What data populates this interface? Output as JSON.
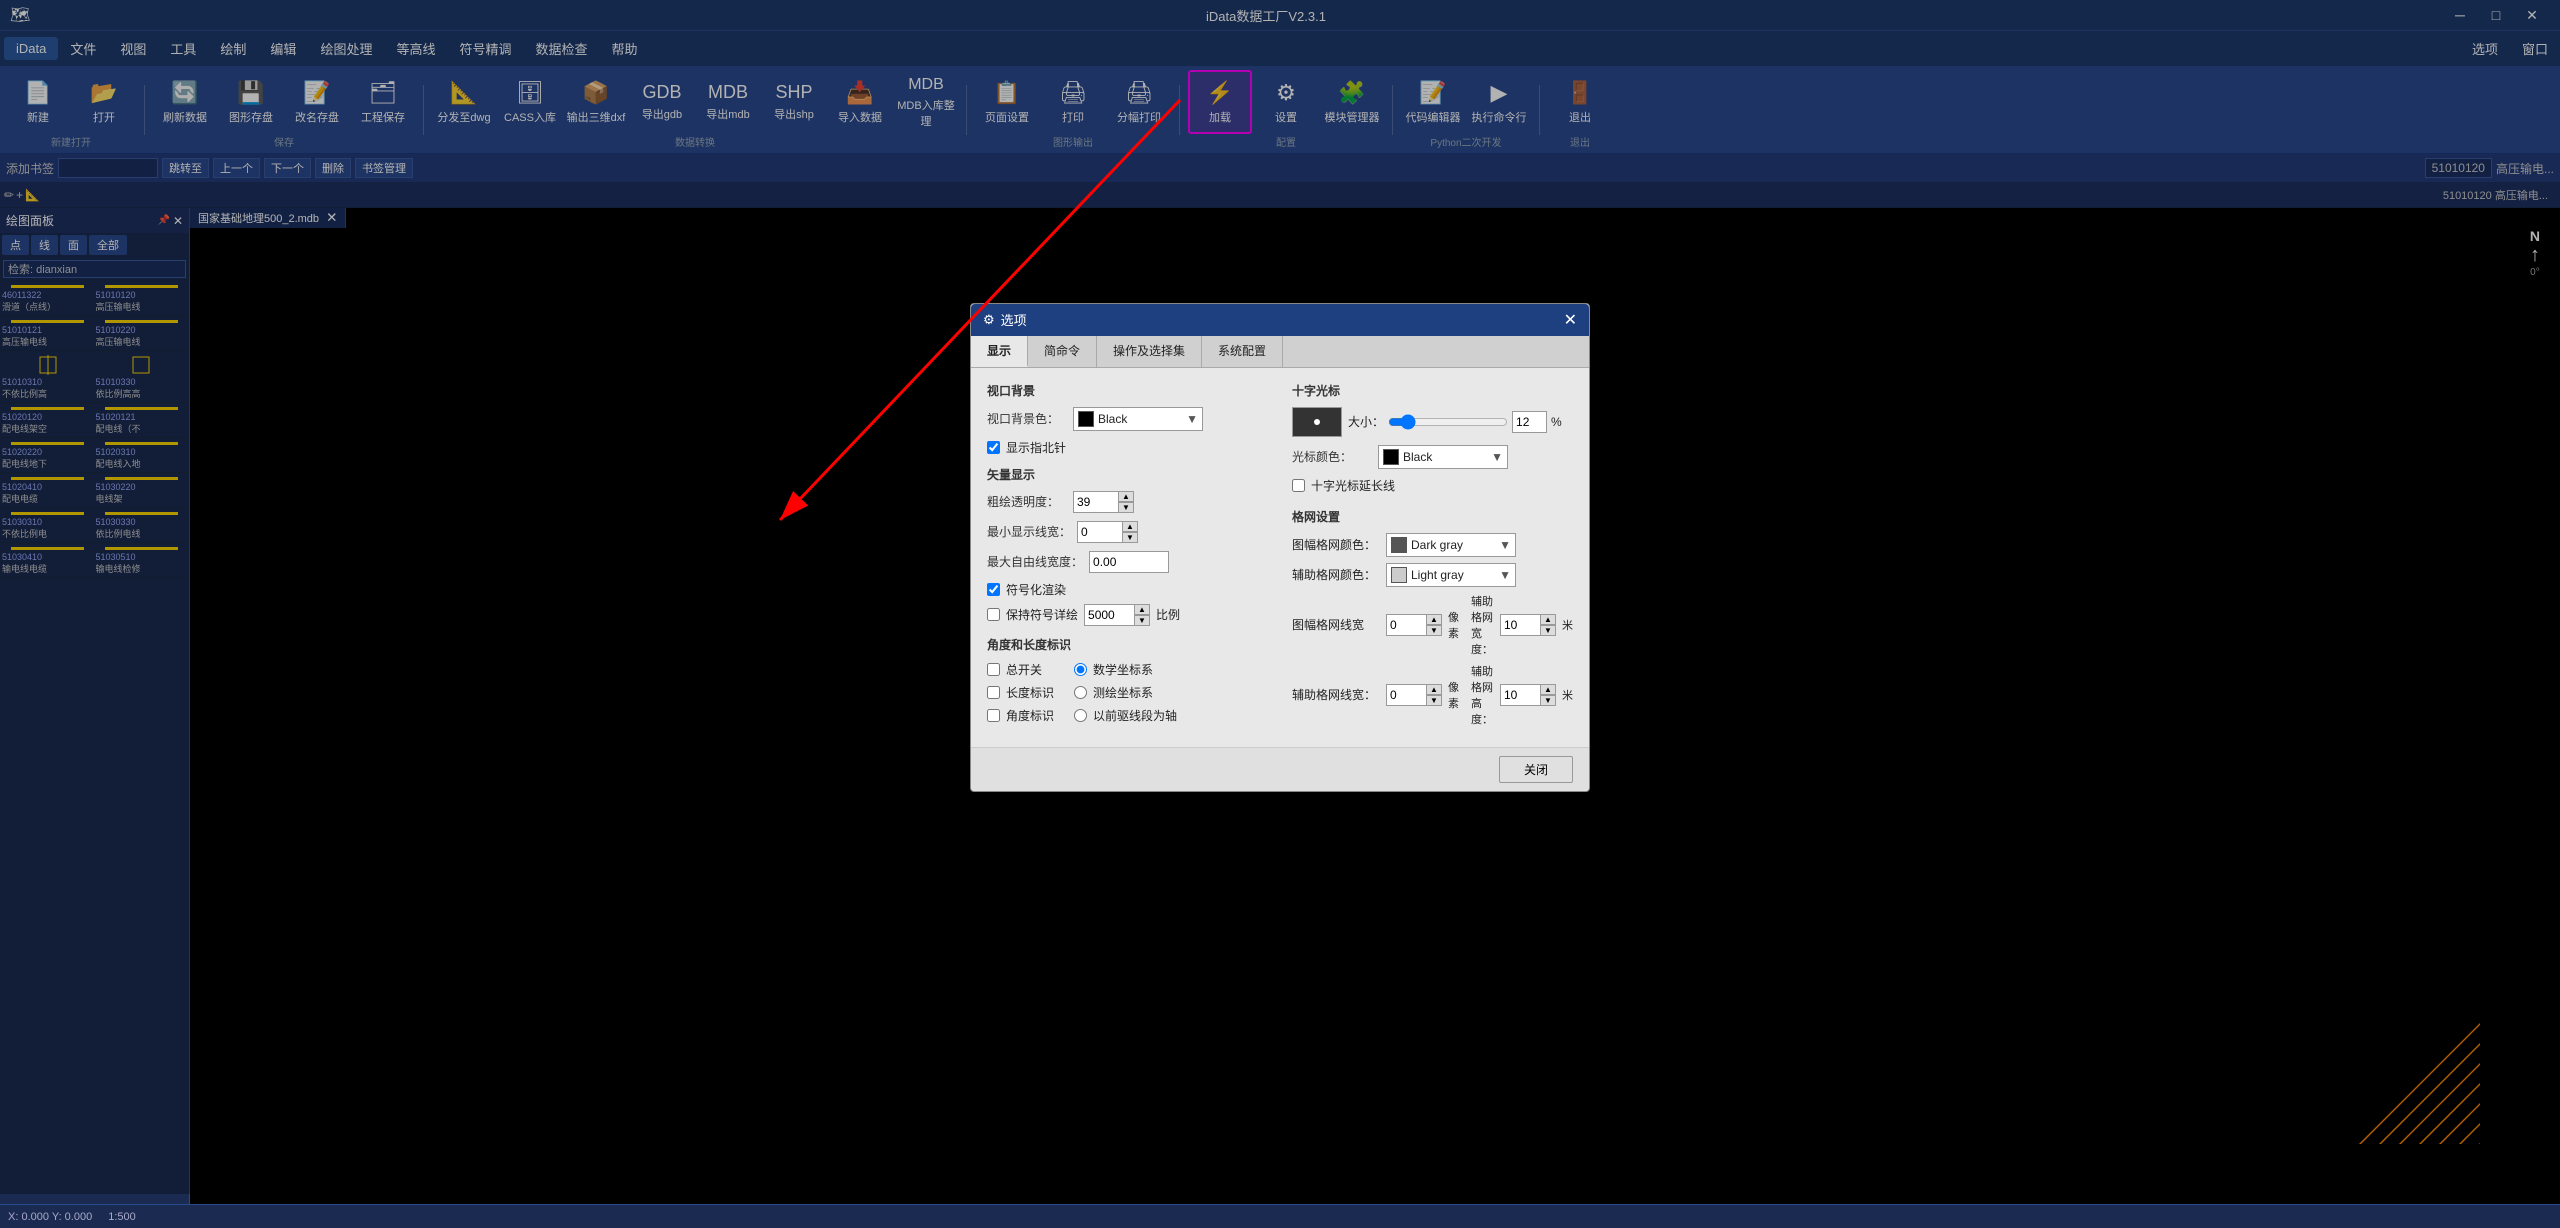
{
  "app": {
    "title": "iData数据工厂V2.3.1",
    "tab_name": "国家基础地理500_2.mdb"
  },
  "title_bar": {
    "minimize": "─",
    "maximize": "□",
    "close": "✕"
  },
  "menu": {
    "items": [
      "iData",
      "文件",
      "视图",
      "工具",
      "绘制",
      "编辑",
      "绘图处理",
      "等高线",
      "符号精调",
      "数据检查",
      "帮助"
    ],
    "right_items": [
      "选项",
      "窗口"
    ]
  },
  "toolbar": {
    "buttons": [
      {
        "label": "新建",
        "icon": "📄",
        "group": "新建打开"
      },
      {
        "label": "打开",
        "icon": "📂",
        "group": "新建打开"
      },
      {
        "label": "刷新数据",
        "icon": "🔄",
        "group": "保存"
      },
      {
        "label": "图形存盘",
        "icon": "💾",
        "group": "保存"
      },
      {
        "label": "改名存盘",
        "icon": "📝",
        "group": "保存"
      },
      {
        "label": "工程保存",
        "icon": "🗂",
        "group": "保存"
      },
      {
        "label": "分发至dwg",
        "icon": "📐",
        "group": "数据转换"
      },
      {
        "label": "CASS入库",
        "icon": "🗄",
        "group": "数据转换"
      },
      {
        "label": "输出三维dxf",
        "icon": "📦",
        "group": "数据转换"
      },
      {
        "label": "导出gdb",
        "icon": "🗃",
        "group": "数据转换"
      },
      {
        "label": "导出mdb",
        "icon": "🗃",
        "group": "数据转换"
      },
      {
        "label": "导出shp",
        "icon": "🗃",
        "group": "数据转换"
      },
      {
        "label": "导入数据",
        "icon": "📥",
        "group": "数据转换"
      },
      {
        "label": "MDB入库整理",
        "icon": "🗄",
        "group": "数据转换"
      },
      {
        "label": "页面设置",
        "icon": "📋",
        "group": "图形输出"
      },
      {
        "label": "打印",
        "icon": "🖨",
        "group": "图形输出"
      },
      {
        "label": "分幅打印",
        "icon": "🖨",
        "group": "图形输出"
      },
      {
        "label": "加载",
        "icon": "⚡",
        "group": "配置",
        "highlighted": true
      },
      {
        "label": "设置",
        "icon": "⚙",
        "group": "配置"
      },
      {
        "label": "模块管理器",
        "icon": "🧩",
        "group": "配置"
      },
      {
        "label": "代码编辑器",
        "icon": "📝",
        "group": "Python二次开发"
      },
      {
        "label": "执行命令行",
        "icon": "▶",
        "group": "Python二次开发"
      },
      {
        "label": "退出",
        "icon": "🚪",
        "group": "退出"
      }
    ]
  },
  "toolbar2": {
    "tags_label": "添加书签",
    "jump_label": "跳转至",
    "prev": "上一个",
    "next": "下一个",
    "delete": "删除",
    "bookmarks_label": "书签管理",
    "code_value": "51010120",
    "code_label": "高压输电..."
  },
  "sidebar": {
    "title": "绘图面板",
    "tabs": [
      "点",
      "线",
      "面",
      "全部"
    ],
    "search_placeholder": "检索: dianxian",
    "items": [
      {
        "code": "46011322",
        "code2": "51010120",
        "name1": "滑道（点线）",
        "name2": "高压输电线"
      },
      {
        "code": "51010121",
        "code2": "51010220",
        "name1": "高压输电线",
        "name2": "高压输电线"
      },
      {
        "code": "51010310",
        "code2": "51010330",
        "name1": "不依比例高",
        "name2": "依比例高高"
      },
      {
        "code": "51020120",
        "code2": "51020121",
        "name1": "配电线架空",
        "name2": "配电线（不"
      },
      {
        "code": "51020220",
        "code2": "51020310",
        "name1": "配电线地下",
        "name2": "配电线入地"
      },
      {
        "code": "51020410",
        "code2": "51030220",
        "name1": "配电电缆",
        "name2": "电线架"
      },
      {
        "code": "51030310",
        "code2": "51030330",
        "name1": "不依比例电",
        "name2": "依比例电线"
      },
      {
        "code": "51030410",
        "code2": "51030510",
        "name1": "输电线电缆",
        "name2": "输电线检修"
      }
    ]
  },
  "dialog": {
    "title": "选项",
    "close_btn": "✕",
    "tabs": [
      "显示",
      "简命令",
      "操作及选择集",
      "系统配置"
    ],
    "active_tab": "显示",
    "sections": {
      "window_bg": {
        "title": "视口背景",
        "bg_color_label": "视口背景色：",
        "bg_color_value": "Black",
        "show_compass_label": "显示指北针",
        "show_compass_checked": true
      },
      "vector": {
        "title": "矢量显示",
        "rough_transparency_label": "粗绘透明度：",
        "rough_transparency_value": "39",
        "min_width_label": "最小显示线宽：",
        "min_width_value": "0",
        "max_free_width_label": "最大自由线宽度：",
        "max_free_width_value": "0.00",
        "symbolic_render_label": "符号化渲染",
        "symbolic_render_checked": true,
        "keep_symbol_detail_label": "保持符号详绘",
        "keep_symbol_detail_checked": false,
        "keep_symbol_scale_value": "5000",
        "keep_symbol_scale_label": "比例"
      },
      "angle_length": {
        "title": "角度和长度标识",
        "master_switch_label": "总开关",
        "master_switch_checked": false,
        "length_mark_label": "长度标识",
        "length_mark_checked": false,
        "angle_mark_label": "角度标识",
        "angle_mark_checked": false,
        "math_coords_label": "数学坐标系",
        "math_coords_checked": true,
        "survey_coords_label": "测绘坐标系",
        "survey_coords_checked": false,
        "prev_segment_label": "以前驱线段为轴",
        "prev_segment_checked": false
      },
      "crosshair": {
        "title": "十字光标",
        "size_label": "大小：",
        "size_value": "12",
        "size_unit": "%",
        "color_label": "光标颜色：",
        "color_value": "Black",
        "extend_line_label": "十字光标延长线",
        "extend_line_checked": false
      },
      "grid": {
        "title": "格网设置",
        "map_grid_color_label": "图幅格网颜色：",
        "map_grid_color_value": "Dark gray",
        "aux_grid_color_label": "辅助格网颜色：",
        "aux_grid_color_value": "Light gray",
        "map_grid_width_label": "图幅格网线宽",
        "map_grid_width_value": "0",
        "map_grid_width_unit": "像素",
        "aux_grid_width_label": "辅助格网宽度：",
        "aux_grid_width_value": "10",
        "aux_grid_width_unit": "米",
        "aux_grid_line_width_label": "辅助格网线宽：",
        "aux_grid_line_width_value": "0",
        "aux_grid_line_width_unit": "像素",
        "aux_grid_height_label": "辅助格网高度：",
        "aux_grid_height_value": "10",
        "aux_grid_height_unit": "米"
      }
    },
    "footer": {
      "close_label": "关闭"
    }
  },
  "status_bar": {
    "coords": "X: 0.000  Y: 0.000",
    "scale": "1:500"
  }
}
